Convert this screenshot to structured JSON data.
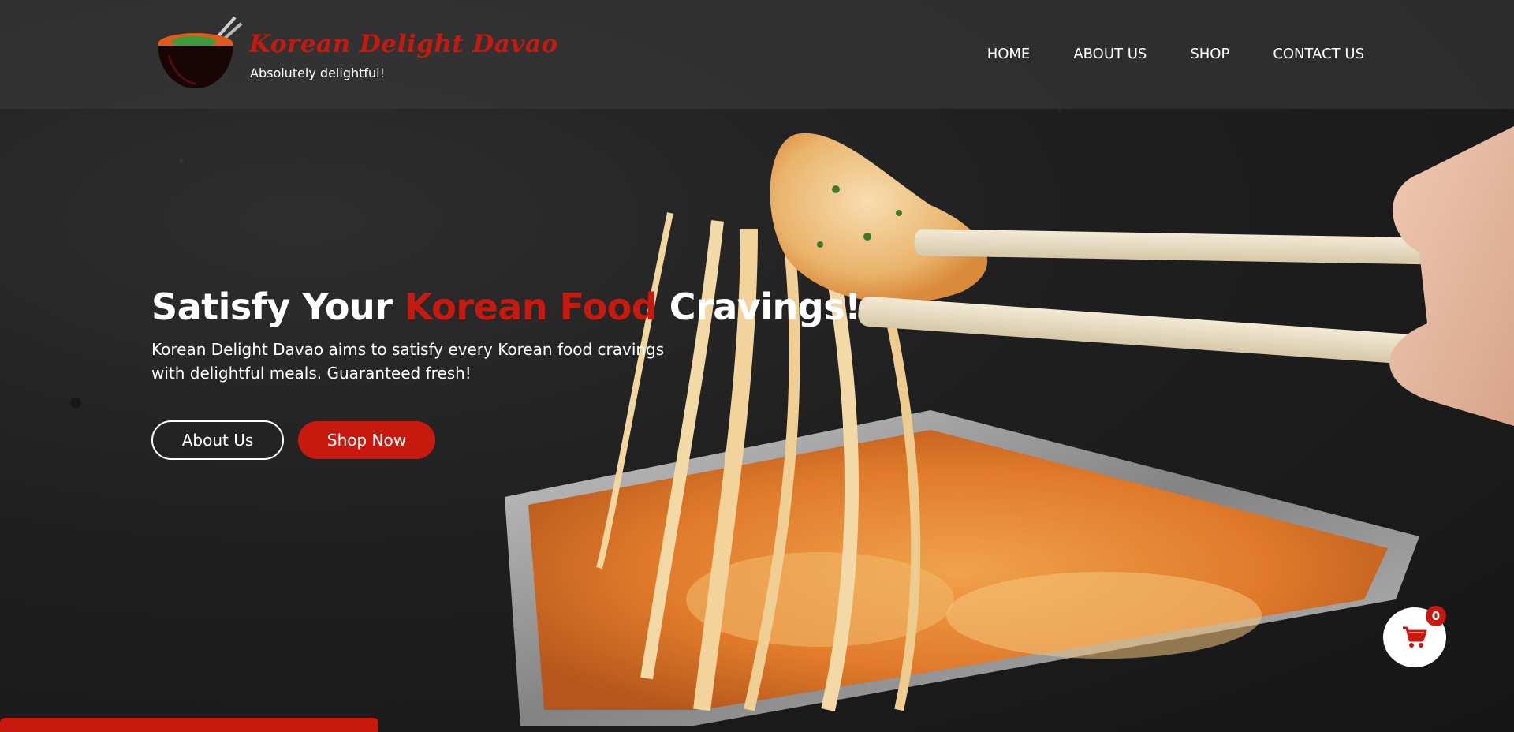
{
  "brand": {
    "name": "Korean Delight Davao",
    "tagline": "Absolutely delightful!"
  },
  "nav": {
    "items": [
      {
        "label": "HOME"
      },
      {
        "label": "ABOUT US"
      },
      {
        "label": "SHOP"
      },
      {
        "label": "CONTACT US"
      }
    ]
  },
  "hero": {
    "title_part1": "Satisfy Your ",
    "title_accent": "Korean Food",
    "title_part2": " Cravings!",
    "description": "Korean Delight Davao aims to satisfy every Korean food cravings with delightful meals. Guaranteed fresh!",
    "about_button": "About Us",
    "shop_button": "Shop Now"
  },
  "cart": {
    "count": "0",
    "icon": "cart-icon"
  },
  "colors": {
    "accent": "#c8190f",
    "text": "#ffffff",
    "background": "#1c1c1c"
  }
}
